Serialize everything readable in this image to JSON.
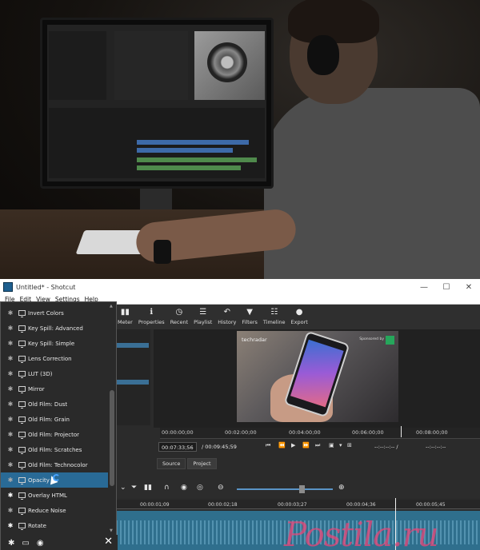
{
  "window": {
    "title": "Untitled* - Shotcut",
    "controls": [
      "—",
      "☐",
      "✕"
    ]
  },
  "menu": [
    "File",
    "Edit",
    "View",
    "Settings",
    "Help"
  ],
  "toolbar": [
    {
      "icon": "meter-icon",
      "glyph": "▮▮",
      "label": "Meter"
    },
    {
      "icon": "properties-icon",
      "glyph": "ℹ",
      "label": "Properties"
    },
    {
      "icon": "recent-icon",
      "glyph": "◷",
      "label": "Recent"
    },
    {
      "icon": "playlist-icon",
      "glyph": "☰",
      "label": "Playlist"
    },
    {
      "icon": "history-icon",
      "glyph": "↶",
      "label": "History"
    },
    {
      "icon": "filters-icon",
      "glyph": "▼",
      "label": "Filters"
    },
    {
      "icon": "timeline-icon",
      "glyph": "☷",
      "label": "Timeline"
    },
    {
      "icon": "export-icon",
      "glyph": "●",
      "label": "Export"
    }
  ],
  "filters": [
    {
      "label": "Invert Colors",
      "favorite": false
    },
    {
      "label": "Key Spill: Advanced",
      "favorite": false
    },
    {
      "label": "Key Spill: Simple",
      "favorite": false
    },
    {
      "label": "Lens Correction",
      "favorite": false
    },
    {
      "label": "LUT (3D)",
      "favorite": false
    },
    {
      "label": "Mirror",
      "favorite": false
    },
    {
      "label": "Old Film: Dust",
      "favorite": false
    },
    {
      "label": "Old Film: Grain",
      "favorite": false
    },
    {
      "label": "Old Film: Projector",
      "favorite": false
    },
    {
      "label": "Old Film: Scratches",
      "favorite": false
    },
    {
      "label": "Old Film: Technocolor",
      "favorite": false
    },
    {
      "label": "Opacity",
      "favorite": false,
      "selected": true
    },
    {
      "label": "Overlay HTML",
      "favorite": true
    },
    {
      "label": "Reduce Noise",
      "favorite": false
    },
    {
      "label": "Rotate",
      "favorite": true
    }
  ],
  "player": {
    "ruler": [
      "00:00:00;00",
      "00:02:00;00",
      "00:04:00;00",
      "00:06:00;00",
      "00:08:00;00"
    ],
    "current_time": "00:07:33;56",
    "total_time": "/ 00:09:45;59",
    "in_point": "--:--:--:-- /",
    "out_point": "--:--:--:--",
    "tabs": [
      "Source",
      "Project"
    ]
  },
  "video": {
    "watermark": "techradar",
    "sponsor": "Sponsored by"
  },
  "timeline": {
    "ruler": [
      "00:00:01;09",
      "00:00:02;18",
      "00:00:03;27",
      "00:00:04;36",
      "00:00:05;45"
    ]
  },
  "site_watermark": "Postila.ru",
  "colors": {
    "selection": "#296a96",
    "track": "#2f6f8d",
    "zoom_slider": "#5a94c7"
  }
}
